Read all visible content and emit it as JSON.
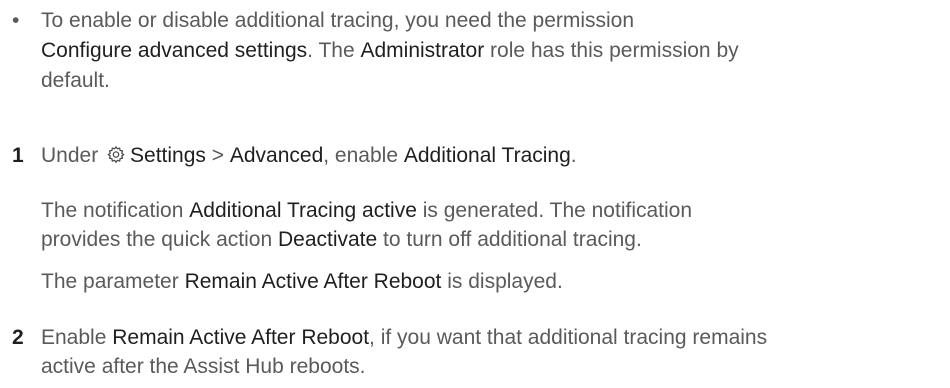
{
  "bullet": {
    "marker": "•",
    "line1": "To enable or disable additional tracing, you need the permission",
    "permission": "Configure advanced settings",
    "line2a": ". The ",
    "role": "Administrator",
    "line2b": " role has this permission by",
    "line3": "default."
  },
  "step1": {
    "number": "1",
    "instr_a": "Under ",
    "settings": "Settings",
    "sep": " > ",
    "advanced": "Advanced",
    "instr_b": ", enable ",
    "feature": "Additional Tracing",
    "instr_c": ".",
    "notif_a": "The notification ",
    "notif_name": "Additional Tracing active",
    "notif_b": " is generated. The notification",
    "notif_c": "provides the quick action ",
    "action": "Deactivate",
    "notif_d": " to turn off additional tracing.",
    "param_a": "The parameter ",
    "param_name": "Remain Active After Reboot",
    "param_b": "  is displayed."
  },
  "step2": {
    "number": "2",
    "text_a": "Enable ",
    "param_name": "Remain Active After Reboot",
    "text_b": ", if you want that additional tracing remains",
    "text_c": "active after the Assist Hub reboots."
  }
}
